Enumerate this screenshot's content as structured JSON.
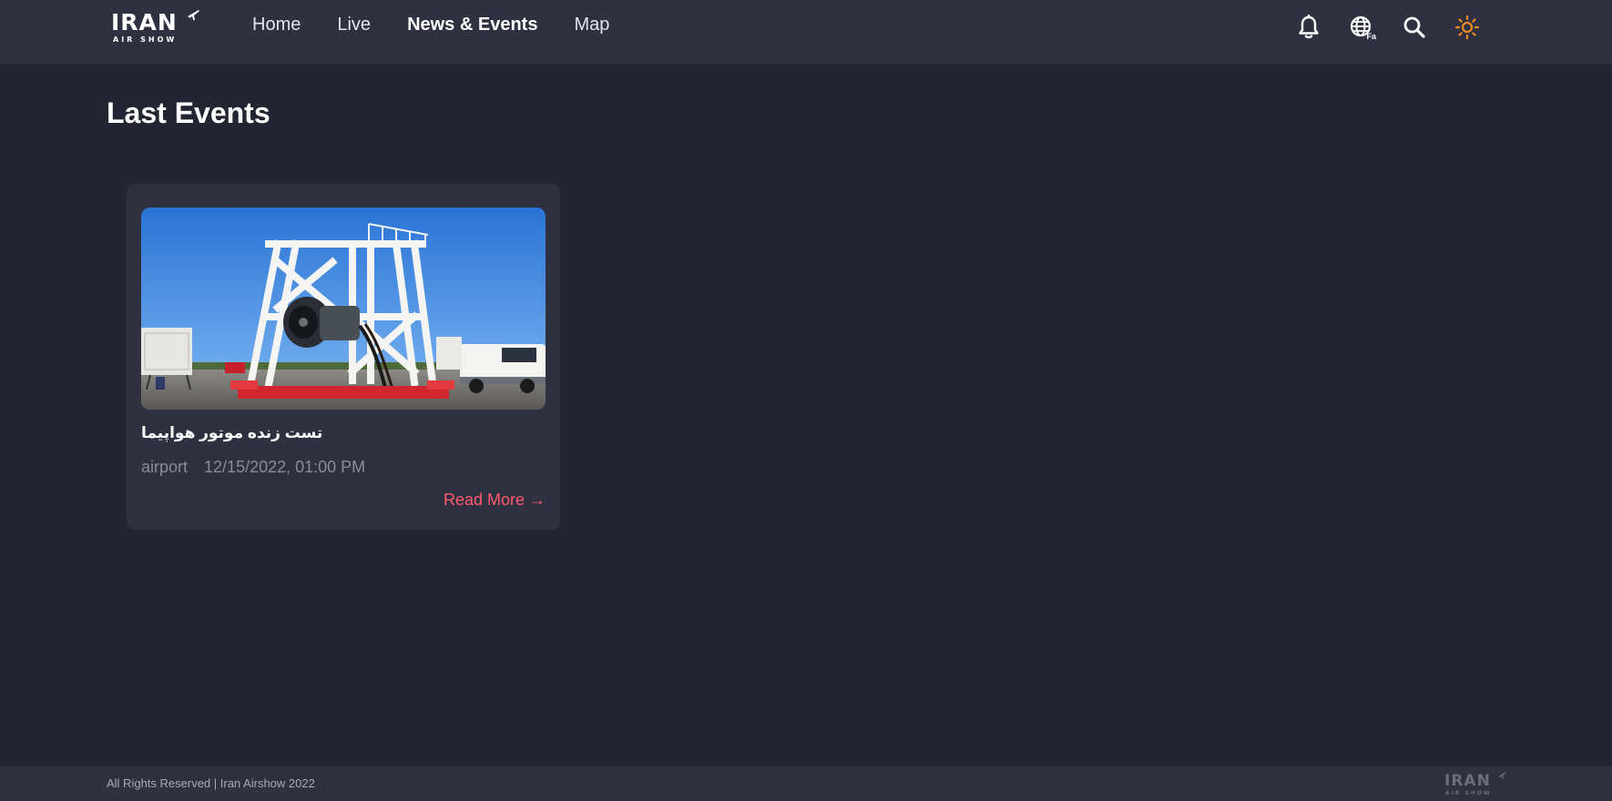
{
  "header": {
    "logo": {
      "main": "IRAN",
      "sub": "AIR SHOW"
    },
    "nav": [
      {
        "label": "Home",
        "active": false
      },
      {
        "label": "Live",
        "active": false
      },
      {
        "label": "News & Events",
        "active": true
      },
      {
        "label": "Map",
        "active": false
      }
    ],
    "icons": {
      "notifications": "bell-icon",
      "language": "globe-icon",
      "language_badge": "Fa",
      "search": "search-icon",
      "theme": "sun-icon"
    }
  },
  "main": {
    "title": "Last Events",
    "events": [
      {
        "title": "تست زنده موتور هواپیما",
        "location": "airport",
        "datetime": "12/15/2022, 01:00 PM",
        "read_more": "Read More →"
      }
    ]
  },
  "footer": {
    "copyright": "All Rights Reserved | Iran Airshow 2022",
    "logo": {
      "main": "IRAN",
      "sub": "AIR SHOW"
    }
  },
  "colors": {
    "background": "#232532",
    "panel": "#2f3140",
    "accent": "#ff5a6e",
    "sun": "#f08a24",
    "muted_text": "#8a8c98"
  }
}
